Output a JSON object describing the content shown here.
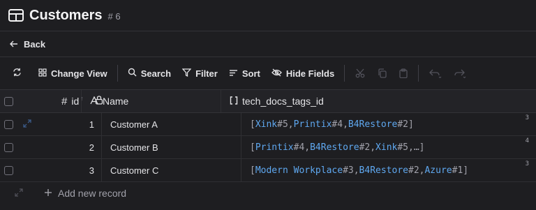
{
  "header": {
    "title": "Customers",
    "count": "# 6"
  },
  "nav": {
    "back_label": "Back"
  },
  "toolbar": {
    "change_view": "Change View",
    "search": "Search",
    "filter": "Filter",
    "sort": "Sort",
    "hide_fields": "Hide Fields"
  },
  "columns": {
    "id": "id",
    "name": "Name",
    "tags": "tech_docs_tags_id"
  },
  "rows": [
    {
      "id": "1",
      "name": "Customer A",
      "badge": "3",
      "tags": [
        {
          "name": "Xink",
          "num": "#5"
        },
        {
          "name": "Printix",
          "num": "#4"
        },
        {
          "name": "B4Restore",
          "num": "#2"
        }
      ],
      "more": ""
    },
    {
      "id": "2",
      "name": "Customer B",
      "badge": "4",
      "tags": [
        {
          "name": "Printix",
          "num": "#4"
        },
        {
          "name": "B4Restore",
          "num": "#2"
        },
        {
          "name": "Xink",
          "num": "#5"
        }
      ],
      "more": "…"
    },
    {
      "id": "3",
      "name": "Customer C",
      "badge": "3",
      "tags": [
        {
          "name": "Modern Workplace",
          "num": "#3"
        },
        {
          "name": "B4Restore",
          "num": "#2"
        },
        {
          "name": "Azure",
          "num": "#1"
        }
      ],
      "more": ""
    }
  ],
  "add_record": "Add new record",
  "colors": {
    "background": "#1e1e21",
    "link": "#5fa8f0",
    "border": "#333337"
  }
}
